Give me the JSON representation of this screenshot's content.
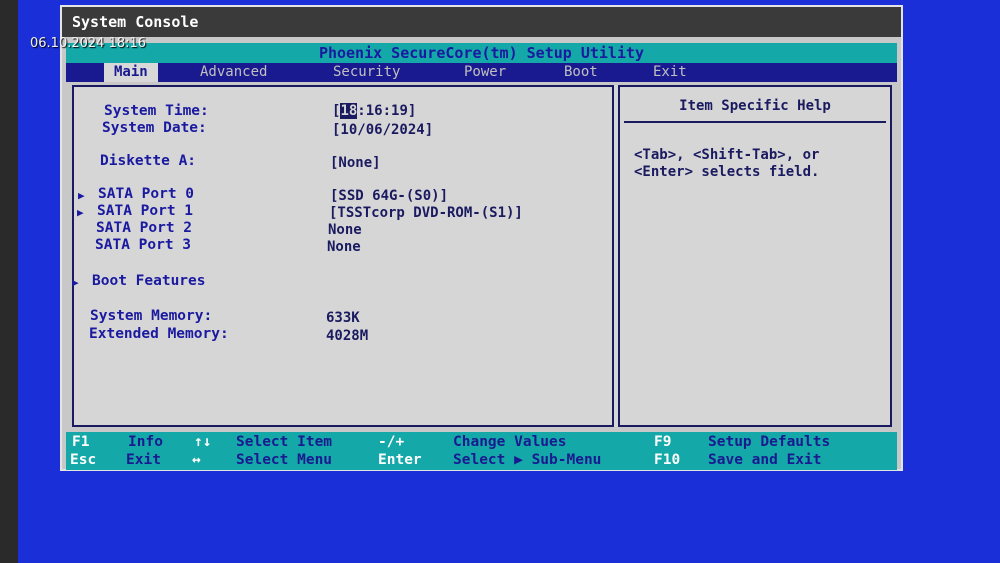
{
  "overlay": {
    "timestamp": "06.10.2024 18:16"
  },
  "window": {
    "title": "System Console"
  },
  "bios": {
    "banner": "Phoenix SecureCore(tm) Setup Utility",
    "tabs": [
      "Main",
      "Advanced",
      "Security",
      "Power",
      "Boot",
      "Exit"
    ],
    "active_tab": "Main"
  },
  "main": {
    "system_time": {
      "label": "System Time:",
      "open": "[",
      "hour": "18",
      "rest": ":16:19]"
    },
    "system_date": {
      "label": "System Date:",
      "value": "[10/06/2024]"
    },
    "diskette": {
      "label": "Diskette A:",
      "value": "[None]"
    },
    "sata": [
      {
        "label": "SATA Port 0",
        "value": "[SSD 64G-(S0)]"
      },
      {
        "label": "SATA Port 1",
        "value": "[TSSTcorp DVD-ROM-(S1)]"
      },
      {
        "label": "SATA Port 2",
        "value": "None"
      },
      {
        "label": "SATA Port 3",
        "value": "None"
      }
    ],
    "boot_features": {
      "label": "Boot Features"
    },
    "system_memory": {
      "label": "System Memory:",
      "value": "633K"
    },
    "extended_memory": {
      "label": "Extended Memory:",
      "value": "4028M"
    }
  },
  "help": {
    "title": "Item Specific Help",
    "line1": "<Tab>, <Shift-Tab>, or",
    "line2": "<Enter> selects field."
  },
  "footer": {
    "r1": {
      "k1": "F1",
      "d1": "Info",
      "k2": "↑↓",
      "d2": "Select Item",
      "k3": "-/+",
      "d3": "Change Values",
      "k4": "F9",
      "d4": "Setup Defaults"
    },
    "r2": {
      "k1": "Esc",
      "d1": "Exit",
      "k2": "↔",
      "d2": "Select Menu",
      "k3": "Enter",
      "d3": "Select ▶ Sub-Menu",
      "k4": "F10",
      "d4": "Save and Exit"
    }
  }
}
